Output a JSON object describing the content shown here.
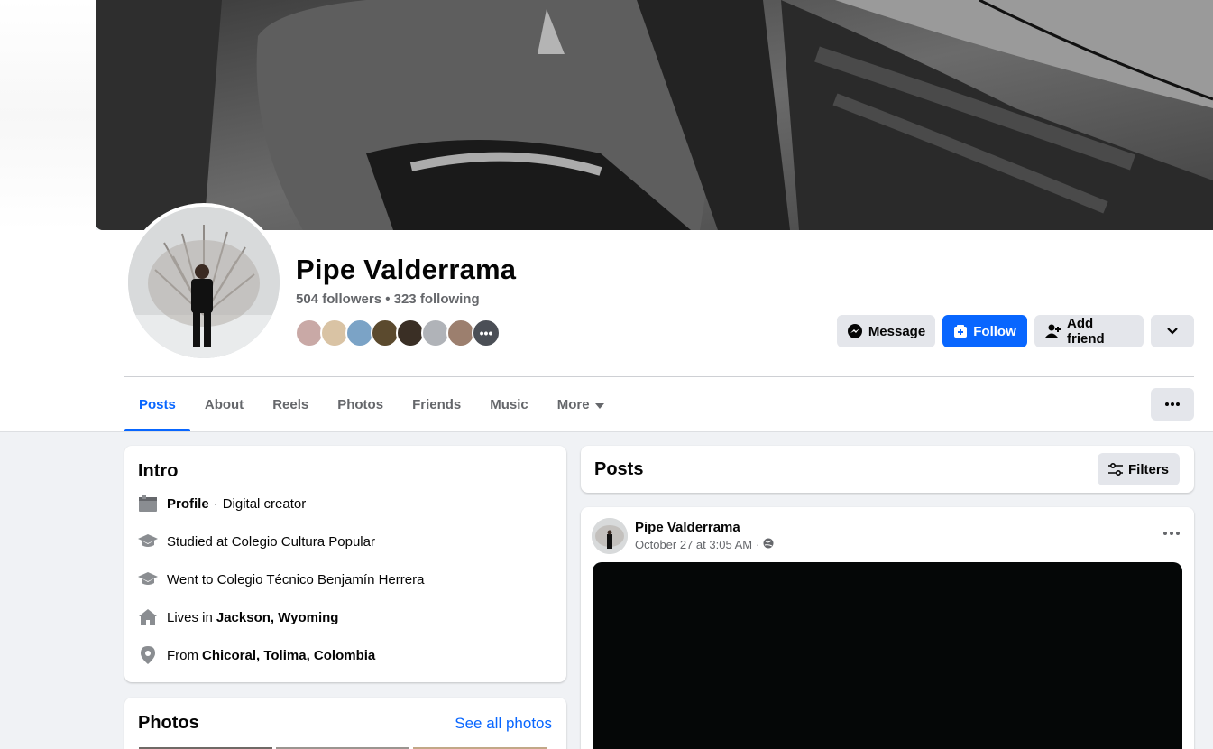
{
  "profile": {
    "name": "Pipe Valderrama",
    "follow_stats": "504 followers • 323 following"
  },
  "actions": {
    "message": "Message",
    "follow": "Follow",
    "add_friend": "Add friend"
  },
  "tabs": [
    {
      "label": "Posts",
      "active": true
    },
    {
      "label": "About"
    },
    {
      "label": "Reels"
    },
    {
      "label": "Photos"
    },
    {
      "label": "Friends"
    },
    {
      "label": "Music"
    },
    {
      "label": "More"
    }
  ],
  "intro": {
    "title": "Intro",
    "items": {
      "profile_bold": "Profile",
      "profile_sep": "·",
      "profile_rest": "Digital creator",
      "studied": "Studied at Colegio Cultura Popular",
      "went": "Went to Colegio Técnico Benjamín Herrera",
      "lives_prefix": "Lives in",
      "lives_place": "Jackson, Wyoming",
      "from_prefix": "From",
      "from_place": "Chicoral, Tolima, Colombia"
    }
  },
  "photos": {
    "title": "Photos",
    "see_all": "See all photos"
  },
  "posts": {
    "title": "Posts",
    "filters": "Filters",
    "post": {
      "author": "Pipe Valderrama",
      "time": "October 27 at 3:05 AM",
      "sep": "·"
    }
  },
  "colors": {
    "accent": "#0866ff",
    "page_bg": "#f0f2f5",
    "muted_text": "#65676b",
    "button_grey": "#e4e6eb"
  }
}
